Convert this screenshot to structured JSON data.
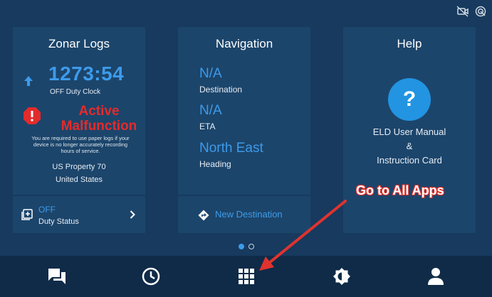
{
  "cards": {
    "logs": {
      "title": "Zonar Logs",
      "clock_value": "1273:54",
      "clock_label": "OFF Duty Clock",
      "malfunction_line1": "Active",
      "malfunction_line2": "Malfunction",
      "malfunction_note_line1": "You are required to use paper logs if your",
      "malfunction_note_line2": "device is no longer accurately recording",
      "malfunction_note_line3": "hours of service.",
      "property_line1": "US Property 70",
      "property_line2": "United States",
      "duty_value": "OFF",
      "duty_label": "Duty Status"
    },
    "navigation": {
      "title": "Navigation",
      "destination_value": "N/A",
      "destination_label": "Destination",
      "eta_value": "N/A",
      "eta_label": "ETA",
      "heading_value": "North East",
      "heading_label": "Heading",
      "new_destination_label": "New Destination"
    },
    "help": {
      "title": "Help",
      "icon_glyph": "?",
      "line1": "ELD User Manual",
      "line2": "&",
      "line3": "Instruction Card"
    }
  },
  "status_icons": [
    "camera-off-icon",
    "signal-icon"
  ],
  "nav_bar": {
    "items": [
      {
        "icon": "messages-icon"
      },
      {
        "icon": "clock-icon"
      },
      {
        "icon": "all-apps-grid-icon"
      },
      {
        "icon": "brightness-icon"
      },
      {
        "icon": "user-profile-icon"
      }
    ]
  },
  "pager": {
    "current": 1,
    "total": 2
  },
  "annotation": {
    "callout_text": "Go to All Apps",
    "color": "#e0332e"
  },
  "colors": {
    "accent": "#3d9bea",
    "alert": "#e32b2b",
    "background": "#173a5e",
    "card": "#1c456b",
    "nav_bar": "#0f2b48"
  }
}
